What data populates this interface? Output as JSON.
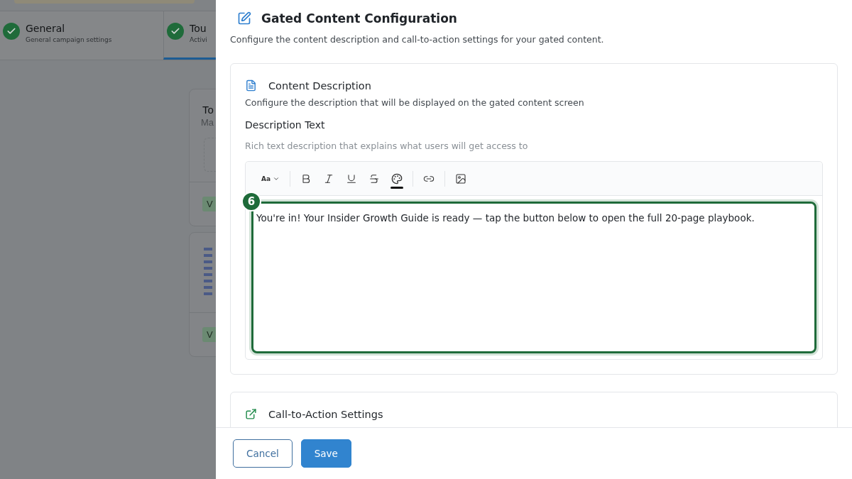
{
  "background": {
    "steps": [
      {
        "title": "General",
        "subtitle": "General campaign settings",
        "done": true,
        "selected": false
      },
      {
        "title": "Tou",
        "subtitle": "Activi",
        "done": true,
        "selected": true
      }
    ],
    "cards": [
      {
        "kind": "text",
        "title": "To",
        "subtitle": "Ma",
        "button": "V"
      },
      {
        "kind": "code",
        "button": "V"
      }
    ]
  },
  "panel": {
    "title": "Gated Content Configuration",
    "subtitle": "Configure the content description and call-to-action settings for your gated content.",
    "sections": [
      {
        "kind": "editor",
        "title": "Content Description",
        "description": "Configure the description that will be displayed on the gated content screen",
        "field_label": "Description Text",
        "field_hint": "Rich text description that explains what users will get access to",
        "toolbar": [
          {
            "kind": "font",
            "label": "Aa"
          },
          {
            "kind": "divider"
          },
          {
            "kind": "bold"
          },
          {
            "kind": "italic"
          },
          {
            "kind": "underline"
          },
          {
            "kind": "strike"
          },
          {
            "kind": "color"
          },
          {
            "kind": "divider"
          },
          {
            "kind": "link"
          },
          {
            "kind": "divider"
          },
          {
            "kind": "image"
          }
        ],
        "value": "You're in! Your Insider Growth Guide is ready — tap the button below to open the full 20-page playbook.",
        "focused": true,
        "badge": "6"
      },
      {
        "kind": "cta",
        "title": "Call-to-Action Settings"
      }
    ],
    "buttons": [
      {
        "kind": "secondary",
        "label": "Cancel"
      },
      {
        "kind": "primary",
        "label": "Save"
      }
    ]
  }
}
